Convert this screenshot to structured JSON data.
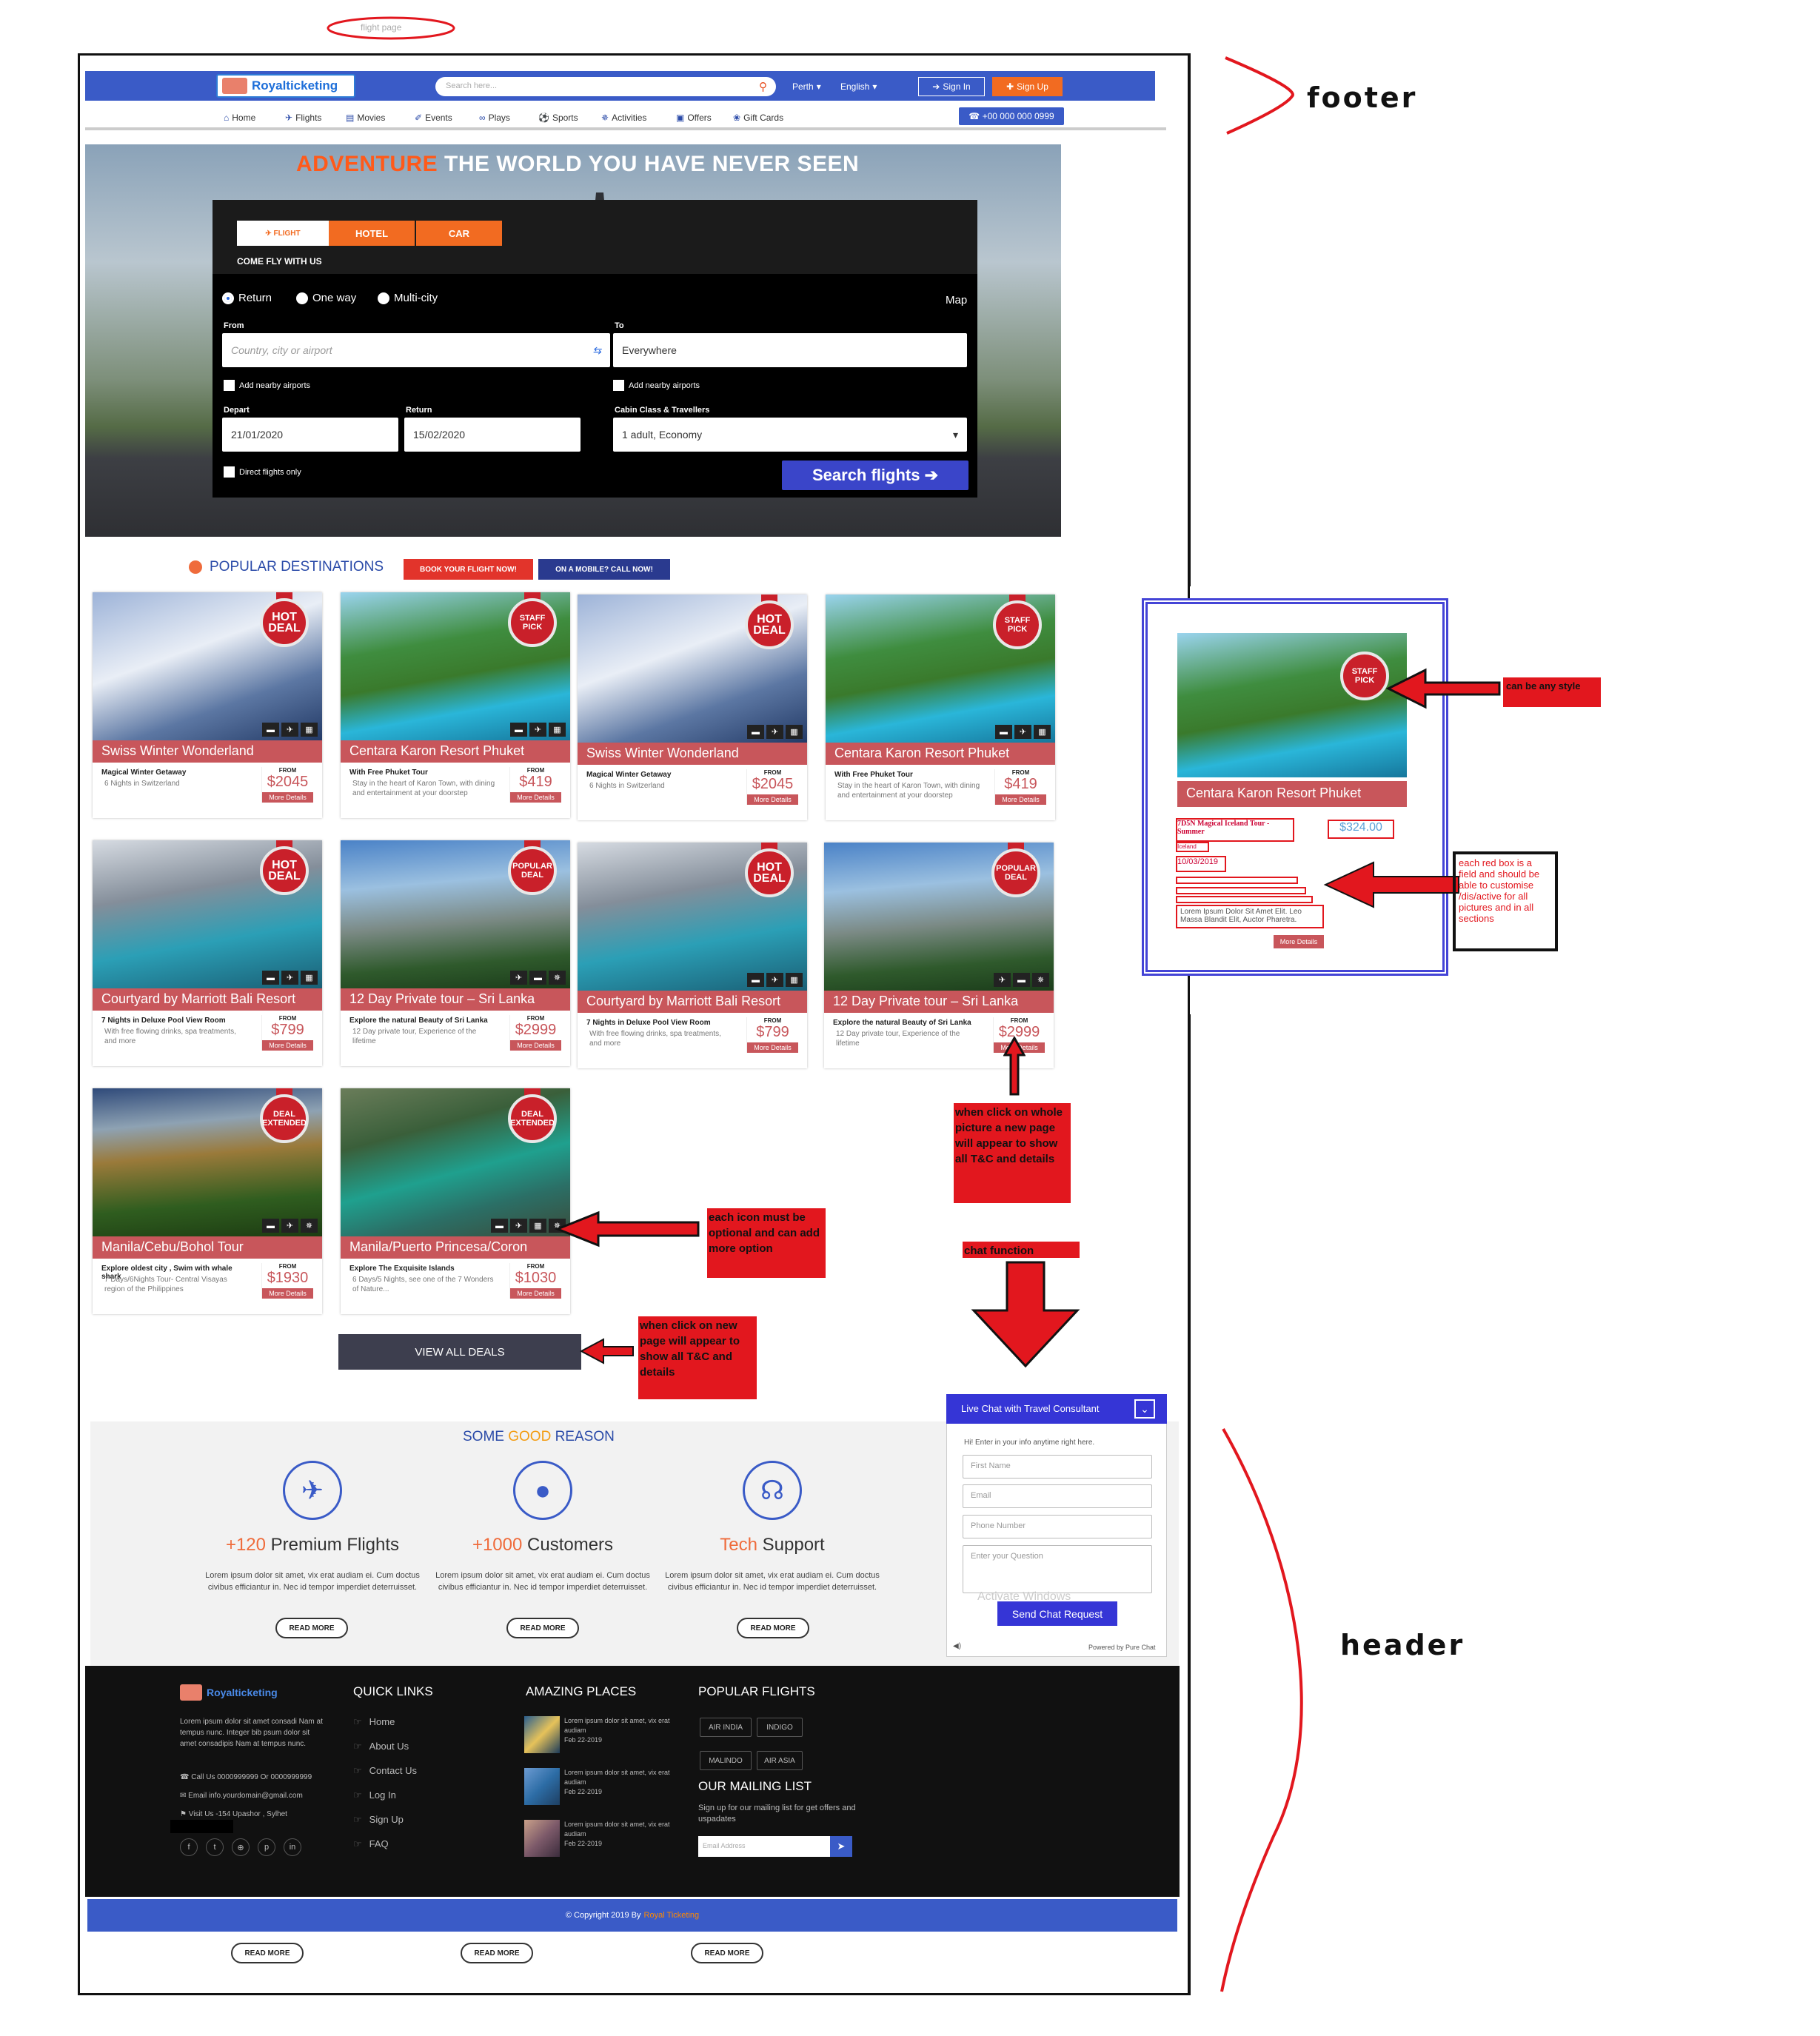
{
  "annotations": {
    "flight_page": "flight page",
    "footer_label": "footer",
    "header_label": "header",
    "can_be_any_style": "can be any style",
    "each_red_box": "each red box is a field and should be able to customise /dis/active  for all pictures and in all sections",
    "when_click_picture": "when click on whole picture a new page will appear to show all T&C and details",
    "each_icon_optional": "each icon must be optional and can add more option",
    "chat_function": "chat function",
    "when_click_view_all": "when click on new page will appear to show all T&C and details"
  },
  "header": {
    "logo_text": "Royalticketing",
    "search_placeholder": "Search here...",
    "city": "Perth",
    "language": "English",
    "sign_in": "Sign In",
    "sign_up": "Sign Up",
    "phone": "+00 000 000 0999",
    "nav": [
      "Home",
      "Flights",
      "Movies",
      "Events",
      "Plays",
      "Sports",
      "Activities",
      "Offers",
      "Gift Cards"
    ]
  },
  "hero": {
    "title_accent": "ADVENTURE",
    "title_rest": "THE WORLD YOU HAVE NEVER SEEN",
    "tabs": [
      "FLIGHT",
      "HOTEL",
      "CAR"
    ],
    "tagline": "COME FLY WITH US",
    "trip_types": [
      "Return",
      "One way",
      "Multi-city"
    ],
    "map_link": "Map",
    "from_label": "From",
    "from_placeholder": "Country, city or airport",
    "to_label": "To",
    "to_value": "Everywhere",
    "nearby": "Add nearby airports",
    "depart_label": "Depart",
    "depart_value": "21/01/2020",
    "return_label": "Return",
    "return_value": "15/02/2020",
    "cabin_label": "Cabin Class & Travellers",
    "cabin_value": "1 adult, Economy",
    "direct": "Direct flights only",
    "search_button": "Search flights"
  },
  "popular": {
    "title": "POPULAR DESTINATIONS",
    "book_btn": "BOOK YOUR FLIGHT NOW!",
    "mobile_btn": "ON A MOBILE? CALL NOW!",
    "from": "FROM",
    "more": "More Details",
    "cards": [
      {
        "title": "Swiss Winter Wonderland",
        "sub": "Magical Winter Getaway",
        "desc": "6 Nights in Switzerland",
        "price": "$2045",
        "badge": "HOT DEAL"
      },
      {
        "title": "Centara Karon Resort Phuket",
        "sub": "With Free Phuket Tour",
        "desc": "Stay in the heart of Karon Town, with dining and entertainment at your doorstep",
        "price": "$419",
        "badge": "STAFF PICK"
      },
      {
        "title": "Swiss Winter Wonderland",
        "sub": "Magical Winter Getaway",
        "desc": "6 Nights in Switzerland",
        "price": "$2045",
        "badge": "HOT DEAL"
      },
      {
        "title": "Centara Karon Resort Phuket",
        "sub": "With Free Phuket Tour",
        "desc": "Stay in the heart of Karon Town, with dining and entertainment at your doorstep",
        "price": "$419",
        "badge": "STAFF PICK"
      },
      {
        "title": "Courtyard by Marriott Bali Resort",
        "sub": "7 Nights in Deluxe Pool View Room",
        "desc": "With free flowing drinks, spa treatments, and more",
        "price": "$799",
        "badge": "HOT DEAL"
      },
      {
        "title": "12 Day Private tour – Sri Lanka",
        "sub": "Explore the natural Beauty of Sri Lanka",
        "desc": "12 Day private tour, Experience of the lifetime",
        "price": "$2999",
        "badge": "POPULAR DEAL"
      },
      {
        "title": "Courtyard by Marriott Bali Resort",
        "sub": "7 Nights in Deluxe Pool View Room",
        "desc": "With free flowing drinks, spa treatments, and more",
        "price": "$799",
        "badge": "HOT DEAL"
      },
      {
        "title": "12 Day Private tour – Sri Lanka",
        "sub": "Explore the natural Beauty of Sri Lanka",
        "desc": "12 Day private tour, Experience of the lifetime",
        "price": "$2999",
        "badge": "POPULAR DEAL"
      },
      {
        "title": "Manila/Cebu/Bohol Tour",
        "sub": "Explore oldest city , Swim with whale shark",
        "desc": "7 Days/6Nights Tour- Central Visayas region of the Philippines",
        "price": "$1930",
        "badge": "DEAL EXTENDED"
      },
      {
        "title": "Manila/Puerto Princesa/Coron",
        "sub": "Explore The Exquisite Islands",
        "desc": "6 Days/5 Nights, see one of the 7 Wonders of Nature...",
        "price": "$1030",
        "badge": "DEAL EXTENDED"
      }
    ],
    "view_all": "VIEW ALL DEALS"
  },
  "side_card": {
    "title": "Centara Karon Resort Phuket",
    "badge": "STAFF PICK",
    "field1": "7D5N Magical Iceland Tour - Summer",
    "field2": "Iceland",
    "price": "$324.00",
    "date": "10/03/2019",
    "desc": "Lorem Ipsum Dolor Sit Amet Elit. Leo Massa Blandit Elit, Auctor Pharetra.",
    "more": "More Details"
  },
  "reasons": {
    "title_a": "SOME",
    "title_b": "GOOD",
    "title_c": "REASON",
    "items": [
      {
        "num": "+120",
        "label": "Premium Flights"
      },
      {
        "num": "+1000",
        "label": "Customers"
      },
      {
        "num": "Tech",
        "label": "Support"
      }
    ],
    "text": "Lorem ipsum dolor sit amet, vix erat audiam ei. Cum doctus civibus efficiantur in. Nec id tempor imperdiet deterruisset.",
    "read_more": "READ MORE"
  },
  "chat": {
    "title": "Live Chat with Travel Consultant",
    "hint": "Hi! Enter in your info anytime right here.",
    "fields": [
      "First Name",
      "Email",
      "Phone Number",
      "Enter your Question"
    ],
    "send": "Send Chat Request",
    "powered": "Powered by Pure Chat",
    "watermark": "Activate Windows"
  },
  "footer": {
    "logo_text": "Royalticketing",
    "about": "Lorem ipsum dolor sit amet consadi Nam at tempus nunc. Integer bib psum dolor sit amet consadipis Nam at tempus nunc.",
    "call": "Call Us 0000999999 Or 0000999999",
    "email": "Email info.yourdomain@gmail.com",
    "visit": "Visit Us -154 Upashor , Sylhet",
    "quick_title": "QUICK LINKS",
    "quick_links": [
      "Home",
      "About Us",
      "Contact Us",
      "Log In",
      "Sign Up",
      "FAQ"
    ],
    "places_title": "AMAZING PLACES",
    "place_text": "Lorem ipsum dolor sit amet, vix erat audiam",
    "place_date": "Feb 22-2019",
    "flights_title": "POPULAR FLIGHTS",
    "airlines": [
      "AIR INDIA",
      "INDIGO",
      "MALINDO",
      "AIR ASIA"
    ],
    "mail_title": "OUR MAILING LIST",
    "mail_text": "Sign up for our mailing list for get offers and uspadates",
    "mail_placeholder": "Email Address",
    "copyright": "© Copyright 2019 By",
    "copyright_brand": "Royal Ticketing",
    "bottom_read_more": "READ MORE"
  },
  "colors": {
    "brand_blue": "#3a5bc7",
    "accent_orange": "#ef6b3b",
    "card_red": "#c8565b",
    "annotation_red": "#e2171e"
  }
}
